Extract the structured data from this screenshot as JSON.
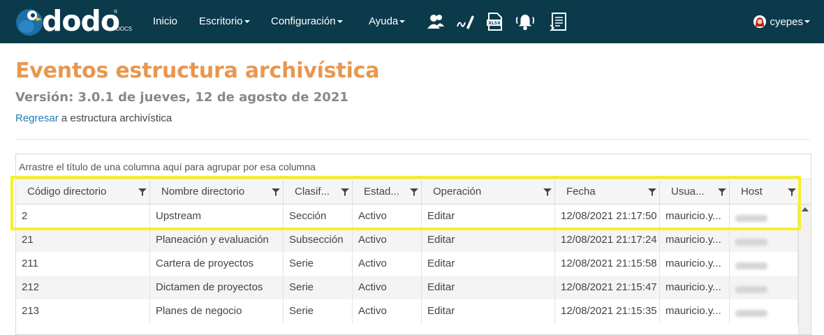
{
  "nav": {
    "logo_text": "dodo",
    "logo_sub": "DOCS",
    "logo_reg": "®",
    "items": [
      "Inicio",
      "Escritorio",
      "Configuración",
      "Ayuda"
    ],
    "user": "cyepes",
    "icons": [
      "users-icon",
      "signature-icon",
      "xlsx-file-icon",
      "bell-icon",
      "document-list-icon"
    ]
  },
  "page": {
    "title": "Eventos estructura archivística",
    "version": "Versión: 3.0.1 de jueves, 12 de agosto de 2021",
    "back_link": "Regresar",
    "back_rest": " a estructura archivística"
  },
  "grid": {
    "group_hint": "Arrastre el título de una columna aquí para agrupar por esa columna",
    "columns": [
      "Código directorio",
      "Nombre directorio",
      "Clasif...",
      "Estad...",
      "Operación",
      "Fecha",
      "Usua...",
      "Host"
    ],
    "rows": [
      [
        "2",
        "Upstream",
        "Sección",
        "Activo",
        "Editar",
        "12/08/2021 21:17:50",
        "mauricio.y..."
      ],
      [
        "21",
        "Planeación y evaluación",
        "Subsección",
        "Activo",
        "Editar",
        "12/08/2021 21:17:24",
        "mauricio.y..."
      ],
      [
        "211",
        "Cartera de proyectos",
        "Serie",
        "Activo",
        "Editar",
        "12/08/2021 21:15:58",
        "mauricio.y..."
      ],
      [
        "212",
        "Dictamen de proyectos",
        "Serie",
        "Activo",
        "Editar",
        "12/08/2021 21:15:47",
        "mauricio.y..."
      ],
      [
        "213",
        "Planes de negocio",
        "Serie",
        "Activo",
        "Editar",
        "12/08/2021 21:15:35",
        "mauricio.y..."
      ]
    ]
  },
  "colors": {
    "nav_bg": "#0b3a4b",
    "title": "#e8974f",
    "link": "#1e7fb5",
    "highlight": "#f6ef2b"
  }
}
